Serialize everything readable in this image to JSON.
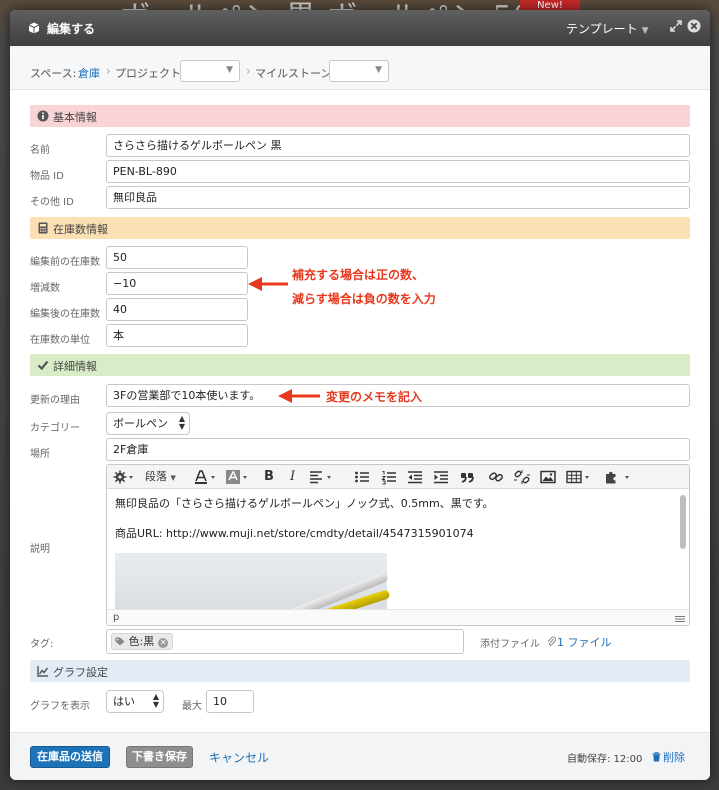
{
  "background": {
    "text": "ボールペン 黒 ボールペン 50 本",
    "badge": "New!"
  },
  "titlebar": {
    "title": "編集する",
    "template_label": "テンプレート"
  },
  "context": {
    "space_label": "スペース:",
    "space_value": "倉庫",
    "project_label": "プロジェクト",
    "project_value": "",
    "milestone_label": "マイルストーン",
    "milestone_value": ""
  },
  "sections": {
    "basic": "基本情報",
    "stock": "在庫数情報",
    "detail": "詳細情報",
    "graph": "グラフ設定"
  },
  "basic": {
    "name_label": "名前",
    "name_value": "さらさら描けるゲルボールペン 黒",
    "item_id_label": "物品 ID",
    "item_id_value": "PEN-BL-890",
    "other_id_label": "その他 ID",
    "other_id_value": "無印良品"
  },
  "stock": {
    "before_label": "編集前の在庫数",
    "before_value": "50",
    "delta_label": "増減数",
    "delta_value": "−10",
    "after_label": "編集後の在庫数",
    "after_value": "40",
    "unit_label": "在庫数の単位",
    "unit_value": "本"
  },
  "annotations": {
    "delta_line1": "補充する場合は正の数、",
    "delta_line2": "減らす場合は負の数を入力",
    "reason_note": "変更のメモを記入"
  },
  "detail": {
    "reason_label": "更新の理由",
    "reason_value": "3Fの営業部で10本使います。",
    "category_label": "カテゴリー",
    "category_value": "ボールペン",
    "location_label": "場所",
    "location_value": "2F倉庫",
    "description_label": "説明",
    "description_line1": "無印良品の「さらさら描けるゲルボールペン」ノック式、0.5mm、黒です。",
    "description_line2": "商品URL: http://www.muji.net/store/cmdty/detail/4547315901074",
    "editor_path": "p",
    "paragraph_label": "段落",
    "tags_label": "タグ:",
    "tag_value": "色:黒",
    "attachment_label": "添付ファイル",
    "attachment_link": "1 ファイル"
  },
  "graph": {
    "show_label": "グラフを表示",
    "show_value": "はい",
    "max_label": "最大",
    "max_value": "10"
  },
  "footer": {
    "submit_label": "在庫品の送信",
    "draft_label": "下書き保存",
    "cancel_label": "キャンセル",
    "autosave_text": "自動保存: 12:00",
    "delete_label": "削除"
  },
  "colors": {
    "primary": "#1e73b8",
    "link": "#1d6fb8",
    "annotation": "#e8391e",
    "section_basic": "#f9d4d6",
    "section_stock": "#fbe0b4",
    "section_detail": "#d9ecc8",
    "section_graph": "#e3ecf6"
  },
  "icons": [
    "cube-icon",
    "expand-icon",
    "close-icon",
    "info-icon",
    "calculator-icon",
    "check-icon",
    "chart-icon",
    "tag-icon",
    "paperclip-icon",
    "trash-icon"
  ]
}
